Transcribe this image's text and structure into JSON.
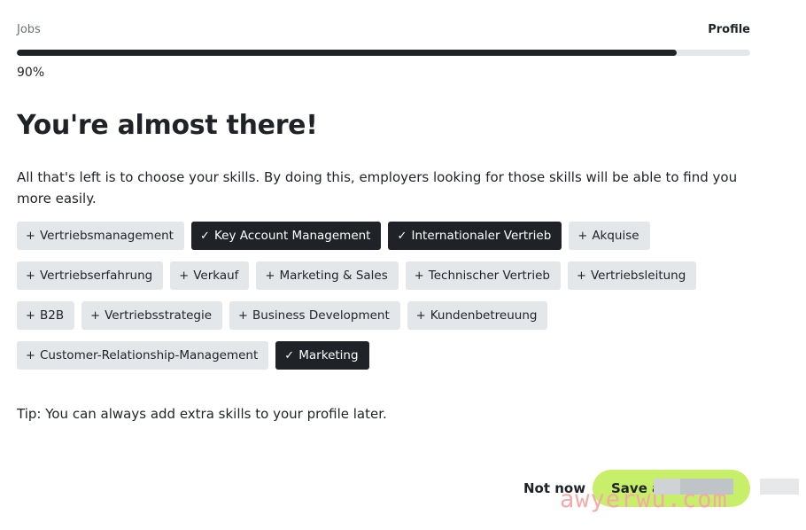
{
  "steps": {
    "left": "Jobs",
    "right": "Profile"
  },
  "progress": {
    "percent": 90,
    "label": "90%"
  },
  "title": "You're almost there!",
  "description": "All that's left is to choose your skills. By doing this, employers looking for those skills will be able to find you more easily.",
  "skills": [
    {
      "label": "Vertriebsmanagement",
      "selected": false
    },
    {
      "label": "Key Account Management",
      "selected": true
    },
    {
      "label": "Internationaler Vertrieb",
      "selected": true
    },
    {
      "label": "Akquise",
      "selected": false
    },
    {
      "label": "Vertriebserfahrung",
      "selected": false
    },
    {
      "label": "Verkauf",
      "selected": false
    },
    {
      "label": "Marketing & Sales",
      "selected": false
    },
    {
      "label": "Technischer Vertrieb",
      "selected": false
    },
    {
      "label": "Vertriebsleitung",
      "selected": false
    },
    {
      "label": "B2B",
      "selected": false
    },
    {
      "label": "Vertriebsstrategie",
      "selected": false
    },
    {
      "label": "Business Development",
      "selected": false
    },
    {
      "label": "Kundenbetreuung",
      "selected": false
    },
    {
      "label": "Customer-Relationship-Management",
      "selected": false
    },
    {
      "label": "Marketing",
      "selected": true
    }
  ],
  "glyphs": {
    "add": "+",
    "selected": "✓"
  },
  "icons": {
    "add": "plus-icon",
    "selected": "check-icon"
  },
  "tip": "Tip: You can always add extra skills to your profile later.",
  "actions": {
    "not_now": "Not now",
    "save": "Save a"
  },
  "watermark": "awyerwu.com",
  "colors": {
    "accent": "#c8ef69",
    "dark": "#1f2226",
    "chip_bg": "#e3e7ea"
  }
}
